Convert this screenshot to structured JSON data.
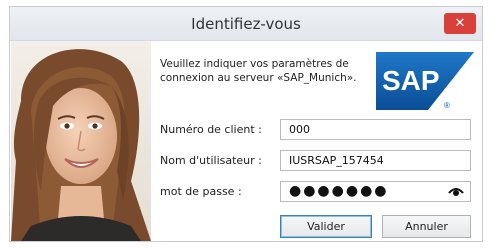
{
  "window": {
    "title": "Identifiez-vous"
  },
  "info": {
    "line1": "Veuillez indiquer vos paramètres de",
    "line2": "connexion au serveur «SAP_Munich»."
  },
  "logo": {
    "text": "SAP",
    "registered": "®",
    "brand_color": "#0d5aa7"
  },
  "form": {
    "client_label": "Numéro de client :",
    "client_value": "000",
    "user_label": "Nom d'utilisateur :",
    "user_value": "IUSRSAP_157454",
    "password_label": "mot de passe :",
    "password_value": "●●●●●●●"
  },
  "buttons": {
    "ok": "Valider",
    "cancel": "Annuler"
  },
  "icons": {
    "close": "close-icon",
    "eye": "eye-icon"
  },
  "colors": {
    "close_button": "#d9403a",
    "accent": "#3c7fb1"
  }
}
